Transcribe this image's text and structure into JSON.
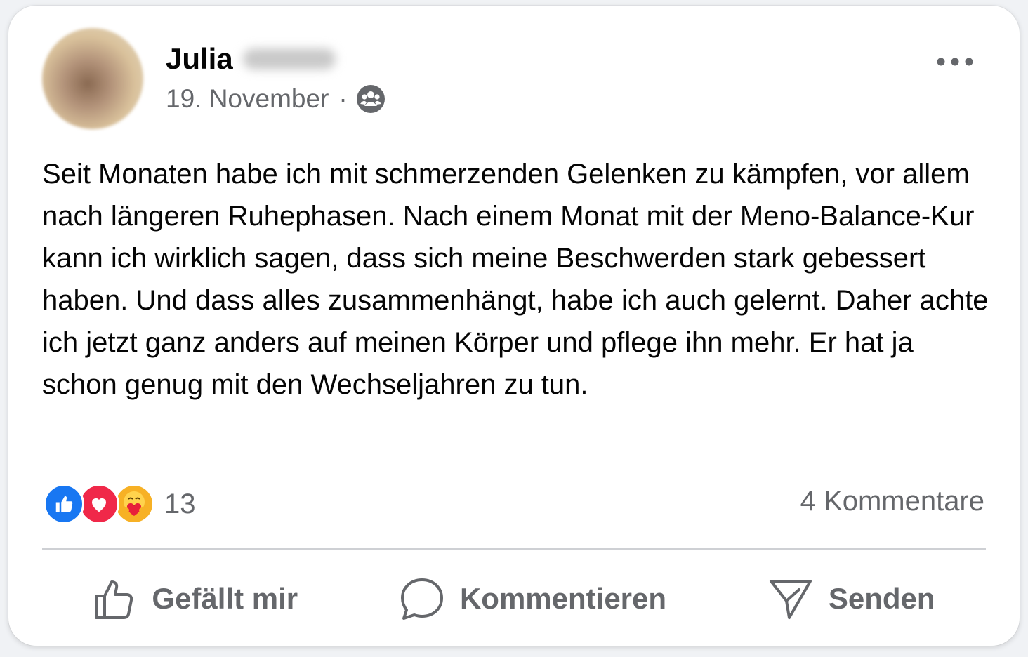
{
  "post": {
    "author_first_name": "Julia",
    "date": "19. November",
    "separator": "·",
    "audience_icon": "group-audience-icon",
    "text": "Seit Monaten habe ich mit schmerzenden Gelenken zu kämpfen, vor allem nach längeren Ruhephasen. Nach einem Monat mit der Meno-Balance-Kur kann ich wirklich sagen, dass sich meine Beschwerden stark gebessert haben. Und dass alles zusammenhängt, habe ich auch gelernt. Daher achte ich jetzt ganz anders auf meinen Körper und pflege ihn mehr. Er hat ja schon genug mit den Wechseljahren zu tun."
  },
  "stats": {
    "reaction_icons": [
      "like-reaction-icon",
      "love-reaction-icon",
      "care-reaction-icon"
    ],
    "reaction_count": "13",
    "comments": "4 Kommentare"
  },
  "actions": {
    "like": "Gefällt mir",
    "comment": "Kommentieren",
    "send": "Senden"
  },
  "colors": {
    "like_blue": "#1877f2",
    "love_red": "#f02849",
    "care_yellow": "#f7b125",
    "secondary_text": "#65676b",
    "primary_text": "#050505"
  }
}
